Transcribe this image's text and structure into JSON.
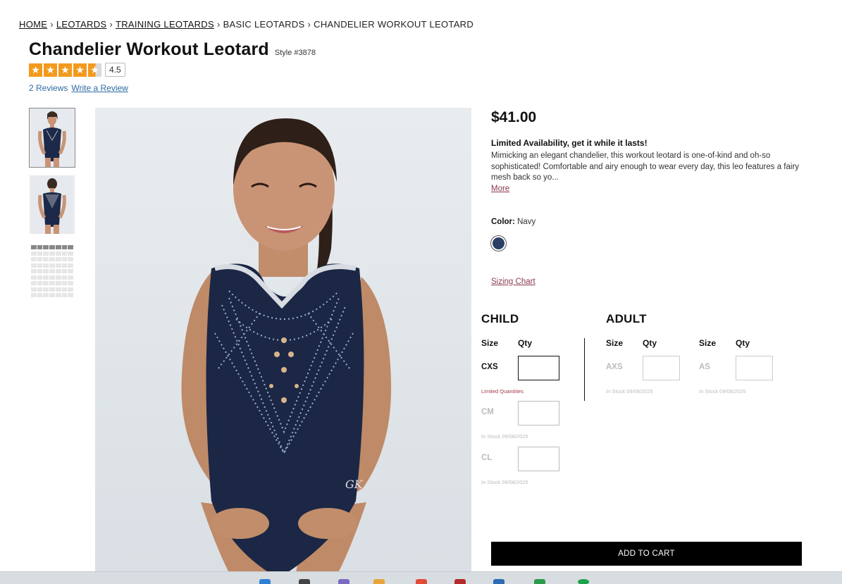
{
  "breadcrumb": [
    {
      "label": "HOME",
      "link": true
    },
    {
      "label": "LEOTARDS",
      "link": true
    },
    {
      "label": "TRAINING LEOTARDS",
      "link": true
    },
    {
      "label": "BASIC LEOTARDS",
      "link": false
    },
    {
      "label": "CHANDELIER WORKOUT LEOTARD",
      "link": false
    }
  ],
  "product": {
    "title": "Chandelier Workout Leotard",
    "style": "Style #3878",
    "rating_value": "4.5",
    "rating_stars": 4.5,
    "reviews_link": "2 Reviews",
    "write_review": "Write a Review",
    "price": "$41.00",
    "availability": "Limited Availability, get it while it lasts!",
    "description": "Mimicking an elegant chandelier, this workout leotard is one-of-kind and oh-so sophisticated! Comfortable and airy enough to wear every day, this leo features a fairy mesh back so yo...",
    "more": "More",
    "color_label": "Color:",
    "color_value": "Navy",
    "swatch_color": "#2b3f66",
    "sizing_chart": "Sizing Chart"
  },
  "sizes": {
    "child_title": "CHILD",
    "adult_title": "ADULT",
    "size_header": "Size",
    "qty_header": "Qty",
    "child": [
      {
        "size": "CXS",
        "note": "Limited Quantities"
      },
      {
        "size": "CM",
        "note": "In Stock 09/08/2025"
      },
      {
        "size": "CL",
        "note": "In Stock 09/08/2025"
      }
    ],
    "adult": [
      {
        "size": "AXS",
        "note": "In Stock 09/08/2025"
      },
      {
        "size": "AS",
        "note": "In Stock 09/08/2025"
      }
    ]
  },
  "cart_label": "ADD TO CART",
  "icons": {
    "star": "star-icon",
    "swatch": "color-swatch"
  },
  "colors": {
    "accent_star": "#f39a1e",
    "link": "#2d6aa3",
    "maroon": "#8a3b4e",
    "cart_bg": "#000000"
  }
}
